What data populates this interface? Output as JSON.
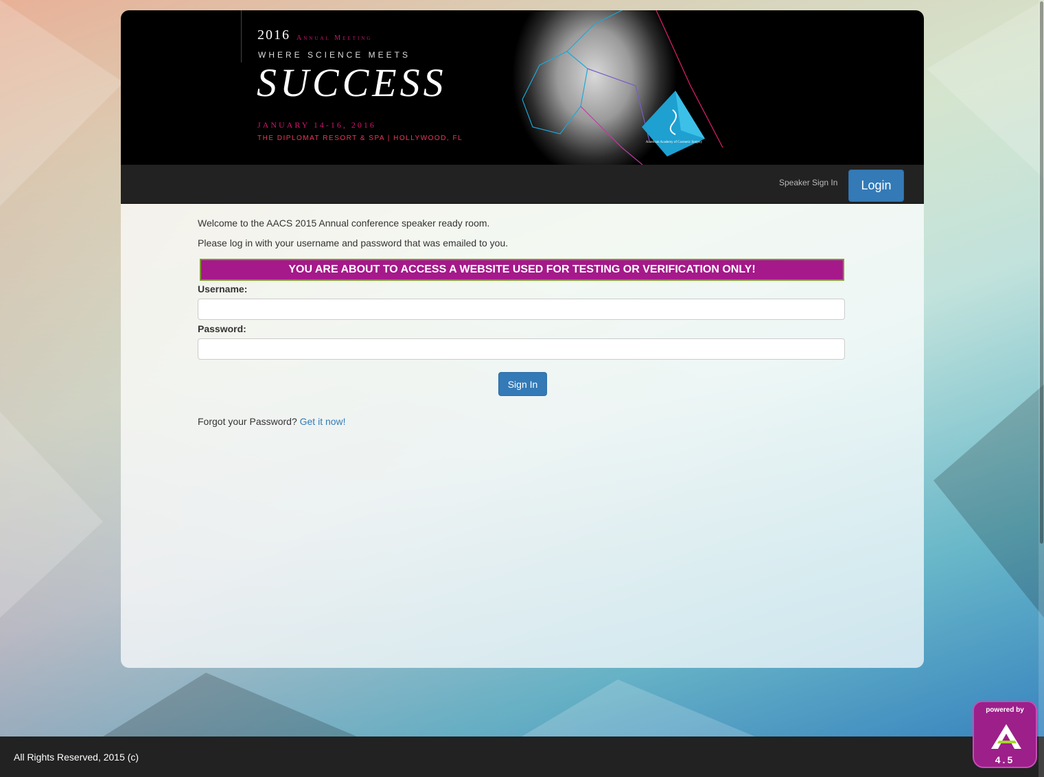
{
  "banner": {
    "year": "2016",
    "annual": "Annual Meeting",
    "where": "WHERE SCIENCE MEETS",
    "success": "SUCCESS",
    "date": "JANUARY 14-16, 2016",
    "venue": "THE DIPLOMAT RESORT & SPA  |  HOLLYWOOD, FL",
    "logo_text": "American Academy of Cosmetic Surgery"
  },
  "nav": {
    "speaker_sign_in": "Speaker Sign In",
    "login_label": "Login"
  },
  "content": {
    "welcome": "Welcome to the AACS 2015 Annual conference speaker ready room.",
    "instructions": "Please log in with your username and password that was emailed to you.",
    "warning": "YOU ARE ABOUT TO ACCESS A WEBSITE USED FOR TESTING OR VERIFICATION ONLY!",
    "username_label": "Username:",
    "username_value": "",
    "password_label": "Password:",
    "password_value": "",
    "sign_in_label": "Sign In",
    "forgot_text": "Forgot your Password?",
    "forgot_link": "Get it now!"
  },
  "footer": {
    "copyright": "All Rights Reserved, 2015 (c)"
  },
  "badge": {
    "powered_by": "powered by",
    "version": "4.5"
  },
  "colors": {
    "primary_button": "#337ab7",
    "warning_bg": "#a5198a",
    "accent_magenta": "#d4146f"
  }
}
